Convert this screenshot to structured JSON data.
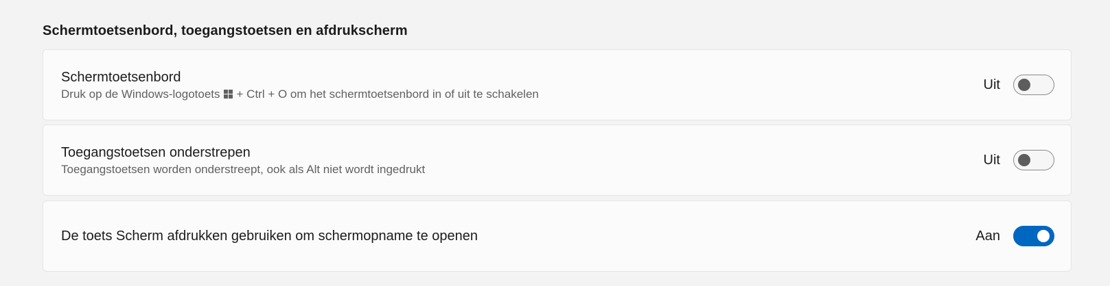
{
  "section": {
    "title": "Schermtoetsenbord, toegangstoetsen en afdrukscherm"
  },
  "settings": [
    {
      "title": "Schermtoetsenbord",
      "description_before": "Druk op de Windows-logotoets",
      "description_icon": "windows-logo-icon",
      "description_after": "+ Ctrl + O om het schermtoetsenbord in of uit te schakelen",
      "state_label": "Uit",
      "on": false
    },
    {
      "title": "Toegangstoetsen onderstrepen",
      "description": "Toegangstoetsen worden onderstreept, ook als Alt niet wordt ingedrukt",
      "state_label": "Uit",
      "on": false
    },
    {
      "title": "De toets Scherm afdrukken gebruiken om schermopname te openen",
      "state_label": "Aan",
      "on": true
    }
  ],
  "colors": {
    "accent": "#0067c0",
    "background": "#f3f3f3",
    "card": "#fbfbfb"
  }
}
